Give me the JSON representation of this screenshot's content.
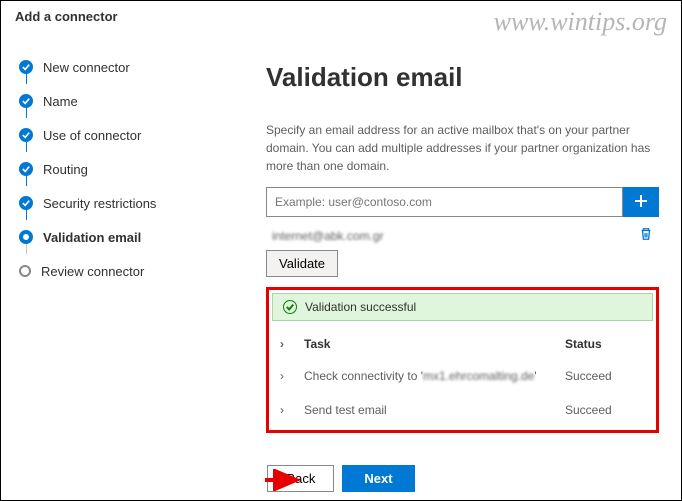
{
  "watermark": "www.wintips.org",
  "header": {
    "title": "Add a connector"
  },
  "sidebar": {
    "steps": [
      {
        "label": "New connector"
      },
      {
        "label": "Name"
      },
      {
        "label": "Use of connector"
      },
      {
        "label": "Routing"
      },
      {
        "label": "Security restrictions"
      },
      {
        "label": "Validation email"
      },
      {
        "label": "Review connector"
      }
    ]
  },
  "content": {
    "title": "Validation email",
    "description": "Specify an email address for an active mailbox that's on your partner domain. You can add multiple addresses if your partner organization has more than one domain.",
    "email_placeholder": "Example: user@contoso.com",
    "added_email": "internet@abk.com.gr",
    "validate_label": "Validate",
    "success_banner": "Validation successful",
    "columns": {
      "task": "Task",
      "status": "Status"
    },
    "tasks": [
      {
        "name_prefix": "Check connectivity to '",
        "name_host": "mx1.ehrcomalting.de",
        "name_suffix": "'",
        "status": "Succeed"
      },
      {
        "name_prefix": "Send test email",
        "name_host": "",
        "name_suffix": "",
        "status": "Succeed"
      }
    ]
  },
  "footer": {
    "back": "Back",
    "next": "Next"
  }
}
